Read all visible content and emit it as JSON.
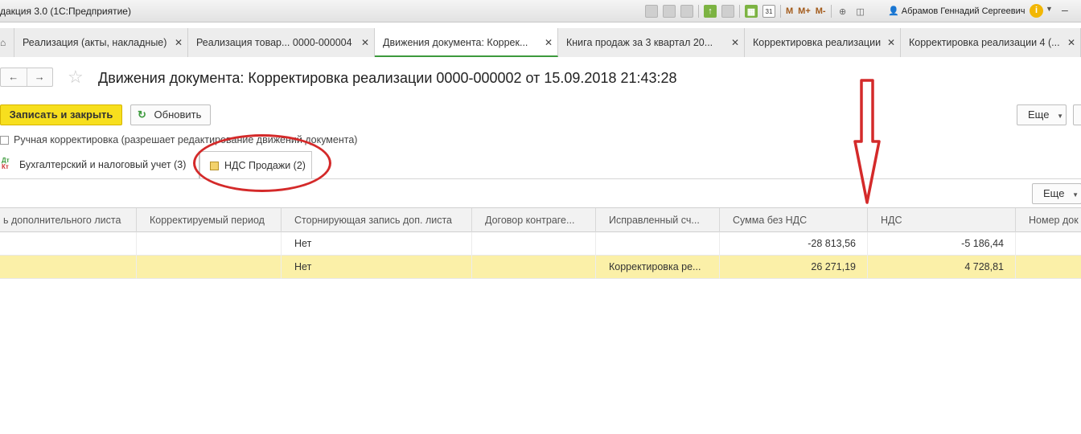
{
  "titlebar": {
    "app_title": "дакция 3.0  (1С:Предприятие)",
    "m_labels": [
      "M",
      "M+",
      "M-"
    ],
    "calendar_day": "31",
    "user_name": "Абрамов Геннадий Сергеевич",
    "info_label": "i"
  },
  "tabs": [
    {
      "label": "Реализация (акты, накладные)"
    },
    {
      "label": "Реализация товар... 0000-000004"
    },
    {
      "label": "Движения документа: Коррек..."
    },
    {
      "label": "Книга продаж за 3 квартал 20..."
    },
    {
      "label": "Корректировка реализации"
    },
    {
      "label": "Корректировка реализации 4 (..."
    }
  ],
  "page": {
    "title": "Движения документа: Корректировка реализации 0000-000002 от 15.09.2018 21:43:28"
  },
  "toolbar": {
    "save_close": "Записать и закрыть",
    "refresh": "Обновить",
    "more": "Еще"
  },
  "manual_edit": {
    "label": "Ручная корректировка (разрешает редактирование движений документа)",
    "checked": false
  },
  "register_tabs": [
    {
      "label": "Бухгалтерский и налоговый учет (3)",
      "icon_top": "Дт",
      "icon_bottom": "Кт"
    },
    {
      "label": "НДС Продажи (2)",
      "active": true
    }
  ],
  "table_toolbar": {
    "more": "Еще"
  },
  "table": {
    "columns": [
      "ь дополнительного листа",
      "Корректируемый период",
      "Сторнирующая запись доп. листа",
      "Договор контраге...",
      "Исправленный сч...",
      "Сумма без НДС",
      "НДС",
      "Номер док"
    ],
    "rows": [
      [
        "",
        "",
        "Нет",
        "",
        "",
        "-28 813,56",
        "-5 186,44",
        ""
      ],
      [
        "",
        "",
        "Нет",
        "",
        "Корректировка ре...",
        "26 271,19",
        "4 728,81",
        ""
      ]
    ],
    "selected_row": 1
  },
  "colors": {
    "accent_green": "#3c9a3c",
    "primary_button": "#f7df1e",
    "selected_row": "#fbf0a8",
    "annotation_red": "#d42a2a"
  }
}
